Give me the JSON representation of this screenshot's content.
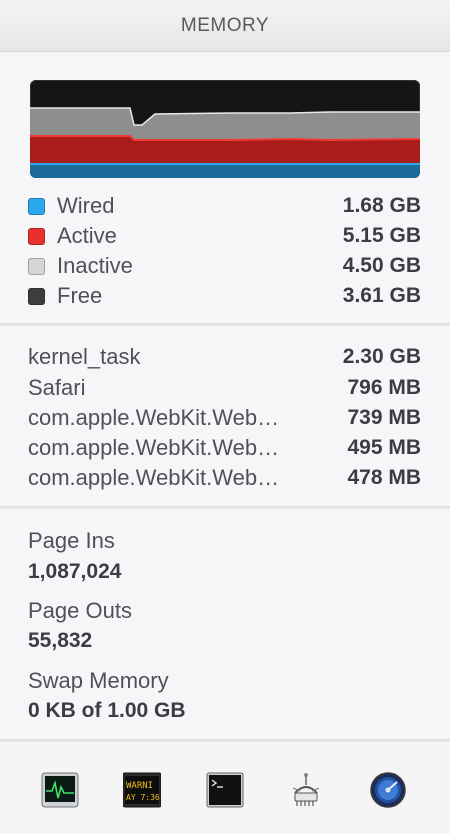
{
  "header": {
    "title": "MEMORY"
  },
  "colors": {
    "wired": "#2aa7ee",
    "active": "#e8302c",
    "inactive": "#d6d6d6",
    "free": "#3d3d3d"
  },
  "memory_breakdown": [
    {
      "label": "Wired",
      "value": "1.68 GB",
      "color": "#2aa7ee"
    },
    {
      "label": "Active",
      "value": "5.15 GB",
      "color": "#e8302c"
    },
    {
      "label": "Inactive",
      "value": "4.50 GB",
      "color": "#d6d6d6"
    },
    {
      "label": "Free",
      "value": "3.61 GB",
      "color": "#3d3d3d"
    }
  ],
  "processes": [
    {
      "name": "kernel_task",
      "value": "2.30 GB"
    },
    {
      "name": "Safari",
      "value": "796 MB"
    },
    {
      "name": "com.apple.WebKit.Web…",
      "value": "739 MB"
    },
    {
      "name": "com.apple.WebKit.Web…",
      "value": "495 MB"
    },
    {
      "name": "com.apple.WebKit.Web…",
      "value": "478 MB"
    }
  ],
  "stats": {
    "page_ins_label": "Page Ins",
    "page_ins_value": "1,087,024",
    "page_outs_label": "Page Outs",
    "page_outs_value": "55,832",
    "swap_label": "Swap Memory",
    "swap_value": "0 KB of 1.00 GB"
  },
  "toolbar": {
    "icons": [
      "activity-monitor-icon",
      "console-icon",
      "terminal-icon",
      "system-information-icon",
      "disk-utility-icon"
    ],
    "console_text_top": "WARNI",
    "console_text_bottom": "AY 7:36"
  }
}
